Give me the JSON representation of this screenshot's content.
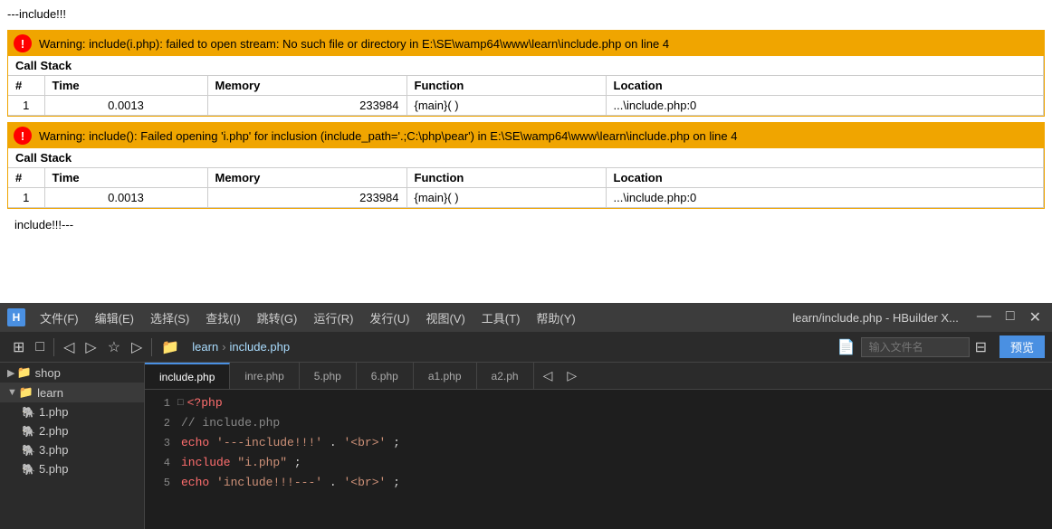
{
  "browser": {
    "output_top": "---include!!!",
    "output_bottom": "include!!!---"
  },
  "warning1": {
    "icon": "!",
    "message": "Warning: include(i.php): failed to open stream: No such file or directory in E:\\SE\\wamp64\\www\\learn\\include.php on line 4",
    "call_stack_label": "Call Stack",
    "columns": [
      "#",
      "Time",
      "Memory",
      "Function",
      "Location"
    ],
    "rows": [
      {
        "num": "1",
        "time": "0.0013",
        "memory": "233984",
        "function": "{main}( )",
        "location": "...\\include.php:0"
      }
    ]
  },
  "warning2": {
    "icon": "!",
    "message": "Warning: include(): Failed opening 'i.php' for inclusion (include_path='.;C:\\php\\pear') in E:\\SE\\wamp64\\www\\learn\\include.php on line 4",
    "call_stack_label": "Call Stack",
    "columns": [
      "#",
      "Time",
      "Memory",
      "Function",
      "Location"
    ],
    "rows": [
      {
        "num": "1",
        "time": "0.0013",
        "memory": "233984",
        "function": "{main}( )",
        "location": "...\\include.php:0"
      }
    ]
  },
  "ide": {
    "title": "learn/include.php - HBuilder X...",
    "logo": "H",
    "menus": [
      "文件(F)",
      "编辑(E)",
      "选择(S)",
      "查找(I)",
      "跳转(G)",
      "运行(R)",
      "发行(U)",
      "视图(V)",
      "工具(T)",
      "帮助(Y)"
    ],
    "toolbar": {
      "icons": [
        "□",
        "□",
        "◁",
        "▷",
        "☆",
        "▷"
      ],
      "breadcrumb": [
        "learn",
        "include.php"
      ],
      "file_search_placeholder": "输入文件名",
      "preview_label": "预览"
    },
    "sidebar": {
      "items": [
        {
          "label": "shop",
          "type": "folder",
          "expanded": false,
          "indent": 0
        },
        {
          "label": "learn",
          "type": "folder",
          "expanded": true,
          "indent": 0
        },
        {
          "label": "1.php",
          "type": "file",
          "indent": 1
        },
        {
          "label": "2.php",
          "type": "file",
          "indent": 1
        },
        {
          "label": "3.php",
          "type": "file",
          "indent": 1
        },
        {
          "label": "5.php",
          "type": "file",
          "indent": 1
        }
      ]
    },
    "tabs": [
      "include.php",
      "inre.php",
      "5.php",
      "6.php",
      "a1.php",
      "a2.ph"
    ],
    "active_tab": 0,
    "code_lines": [
      {
        "num": "1",
        "indicator": "□",
        "content": "<?php",
        "type": "php_tag"
      },
      {
        "num": "2",
        "indicator": "",
        "content": "// include.php",
        "type": "comment"
      },
      {
        "num": "3",
        "indicator": "",
        "content": "echo '---include!!!'.'<br>';",
        "type": "code"
      },
      {
        "num": "4",
        "indicator": "",
        "content": "include \"i.php\";",
        "type": "code"
      },
      {
        "num": "5",
        "indicator": "",
        "content": "echo 'include!!!---'.'<br>';",
        "type": "code"
      }
    ]
  }
}
